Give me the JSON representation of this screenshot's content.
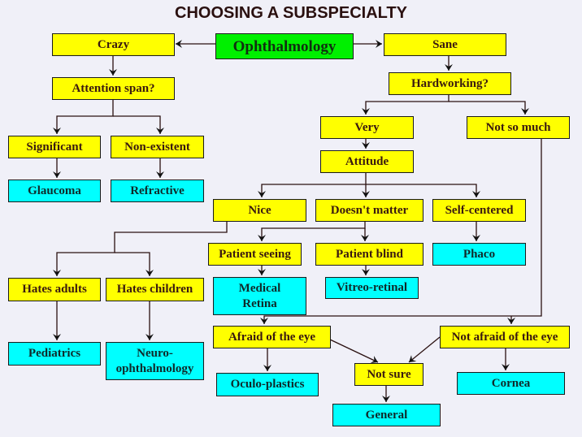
{
  "title": "CHOOSING A SUBSPECIALTY",
  "colors": {
    "background": "#f0f0f8",
    "question_node": "#ffff00",
    "result_node": "#00ffff",
    "root_node": "#00f000",
    "line": "#2a1010"
  },
  "nodes": {
    "ophthalmology": {
      "label": "Ophthalmology",
      "kind": "root"
    },
    "crazy": {
      "label": "Crazy",
      "kind": "question"
    },
    "sane": {
      "label": "Sane",
      "kind": "question"
    },
    "attention_span": {
      "label": "Attention span?",
      "kind": "question"
    },
    "hardworking": {
      "label": "Hardworking?",
      "kind": "question"
    },
    "significant": {
      "label": "Significant",
      "kind": "question"
    },
    "non_existent": {
      "label": "Non-existent",
      "kind": "question"
    },
    "glaucoma": {
      "label": "Glaucoma",
      "kind": "result"
    },
    "refractive": {
      "label": "Refractive",
      "kind": "result"
    },
    "very": {
      "label": "Very",
      "kind": "question"
    },
    "not_so_much": {
      "label": "Not so much",
      "kind": "question"
    },
    "attitude": {
      "label": "Attitude",
      "kind": "question"
    },
    "nice": {
      "label": "Nice",
      "kind": "question"
    },
    "doesnt_matter": {
      "label": "Doesn't matter",
      "kind": "question"
    },
    "self_centered": {
      "label": "Self-centered",
      "kind": "question"
    },
    "patient_seeing": {
      "label": "Patient seeing",
      "kind": "question"
    },
    "patient_blind": {
      "label": "Patient blind",
      "kind": "question"
    },
    "phaco": {
      "label": "Phaco",
      "kind": "result"
    },
    "hates_adults": {
      "label": "Hates adults",
      "kind": "question"
    },
    "hates_children": {
      "label": "Hates children",
      "kind": "question"
    },
    "medical_retina": {
      "label": "Medical Retina",
      "kind": "result"
    },
    "vitreo_retinal": {
      "label": "Vitreo-retinal",
      "kind": "result"
    },
    "afraid_of_eye": {
      "label": "Afraid of the eye",
      "kind": "question"
    },
    "not_afraid_of_eye": {
      "label": "Not afraid of the eye",
      "kind": "question"
    },
    "pediatrics": {
      "label": "Pediatrics",
      "kind": "result"
    },
    "neuro_ophthalmology": {
      "label": "Neuro-ophthalmology",
      "kind": "result"
    },
    "oculo_plastics": {
      "label": "Oculo-plastics",
      "kind": "result"
    },
    "not_sure": {
      "label": "Not sure",
      "kind": "question"
    },
    "general": {
      "label": "General",
      "kind": "result"
    },
    "cornea": {
      "label": "Cornea",
      "kind": "result"
    }
  },
  "edges": [
    [
      "ophthalmology",
      "crazy"
    ],
    [
      "ophthalmology",
      "sane"
    ],
    [
      "crazy",
      "attention_span"
    ],
    [
      "attention_span",
      "significant"
    ],
    [
      "attention_span",
      "non_existent"
    ],
    [
      "significant",
      "glaucoma"
    ],
    [
      "non_existent",
      "refractive"
    ],
    [
      "sane",
      "hardworking"
    ],
    [
      "hardworking",
      "very"
    ],
    [
      "hardworking",
      "not_so_much"
    ],
    [
      "very",
      "attitude"
    ],
    [
      "attitude",
      "nice"
    ],
    [
      "attitude",
      "doesnt_matter"
    ],
    [
      "attitude",
      "self_centered"
    ],
    [
      "self_centered",
      "phaco"
    ],
    [
      "nice",
      "hates_adults"
    ],
    [
      "nice",
      "hates_children"
    ],
    [
      "hates_adults",
      "pediatrics"
    ],
    [
      "hates_children",
      "neuro_ophthalmology"
    ],
    [
      "doesnt_matter",
      "patient_seeing"
    ],
    [
      "doesnt_matter",
      "patient_blind"
    ],
    [
      "patient_seeing",
      "medical_retina"
    ],
    [
      "patient_blind",
      "vitreo_retinal"
    ],
    [
      "not_so_much",
      "afraid_of_eye"
    ],
    [
      "not_so_much",
      "not_afraid_of_eye"
    ],
    [
      "afraid_of_eye",
      "oculo_plastics"
    ],
    [
      "afraid_of_eye",
      "not_sure"
    ],
    [
      "not_afraid_of_eye",
      "not_sure"
    ],
    [
      "not_afraid_of_eye",
      "cornea"
    ],
    [
      "not_sure",
      "general"
    ]
  ]
}
